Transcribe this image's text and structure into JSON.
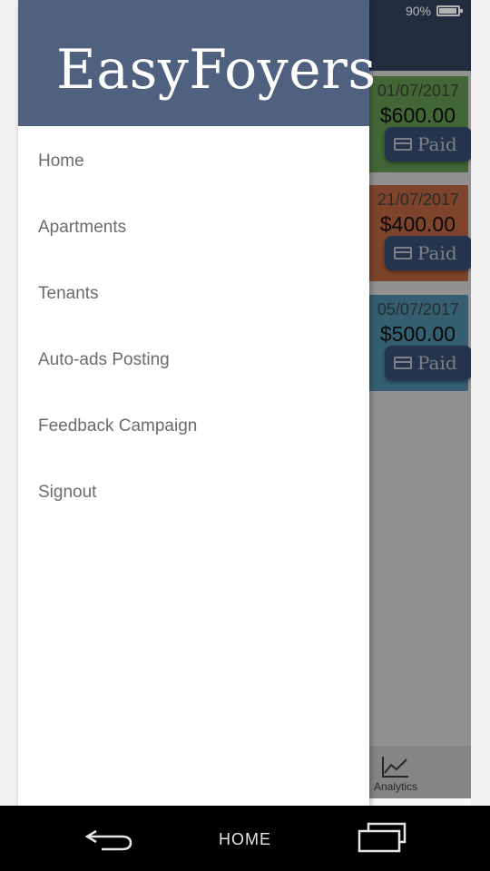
{
  "status_bar": {
    "battery_text": "90%",
    "battery_level": 0.9
  },
  "app": {
    "cards": [
      {
        "date": "01/07/2017",
        "amount": "$600.00",
        "button_label": "Paid",
        "color": "#72b05c"
      },
      {
        "date": "21/07/2017",
        "amount": "$400.00",
        "button_label": "Paid",
        "color": "#d9754b"
      },
      {
        "date": "05/07/2017",
        "amount": "$500.00",
        "button_label": "Paid",
        "color": "#5aa4c2"
      }
    ],
    "bottom_nav": {
      "analytics_label": "Analytics",
      "analytics_icon": "line-chart-icon"
    }
  },
  "drawer": {
    "brand": "EasyFoyers",
    "header_color": "#4f617e",
    "items": [
      {
        "label": "Home"
      },
      {
        "label": "Apartments"
      },
      {
        "label": "Tenants"
      },
      {
        "label": "Auto-ads Posting"
      },
      {
        "label": "Feedback Campaign"
      },
      {
        "label": "Signout"
      }
    ]
  },
  "system_nav": {
    "home_label": "HOME",
    "back_icon": "back-arrow-icon",
    "recents_icon": "recent-apps-icon"
  }
}
